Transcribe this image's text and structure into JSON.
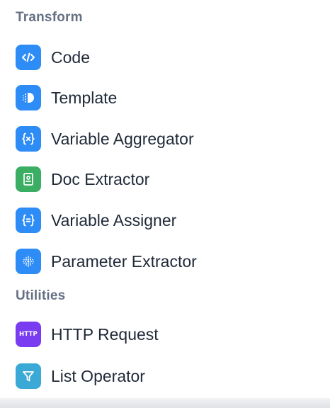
{
  "sections": [
    {
      "title": "Transform"
    },
    {
      "title": "Utilities"
    }
  ],
  "transform_items": [
    {
      "label": "Code",
      "icon": "code-icon",
      "color": "#2e8cf7"
    },
    {
      "label": "Template",
      "icon": "template-icon",
      "color": "#2e8cf7"
    },
    {
      "label": "Variable Aggregator",
      "icon": "variable-aggregator-icon",
      "color": "#2e8cf7"
    },
    {
      "label": "Doc Extractor",
      "icon": "doc-extractor-icon",
      "color": "#3bae63"
    },
    {
      "label": "Variable Assigner",
      "icon": "variable-assigner-icon",
      "color": "#2e8cf7"
    },
    {
      "label": "Parameter Extractor",
      "icon": "parameter-extractor-icon",
      "color": "#2e8cf7"
    }
  ],
  "utility_items": [
    {
      "label": "HTTP Request",
      "icon": "http-request-icon",
      "icon_text": "HTTP",
      "color": "#7a3cf0"
    },
    {
      "label": "List Operator",
      "icon": "list-operator-icon",
      "color": "#3aa9d6"
    }
  ]
}
